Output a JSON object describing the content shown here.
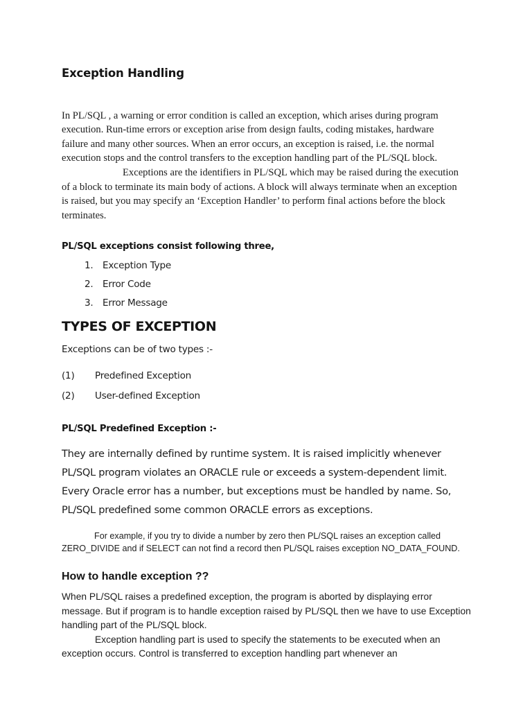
{
  "document": {
    "title": "Exception Handling",
    "intro_paragraph_1": "In PL/SQL , a warning or error condition is called an exception, which arises during program execution. Run-time errors or exception arise from design faults, coding mistakes, hardware failure and many other sources. When an error occurs, an exception is raised, i.e. the normal execution stops and the control transfers to the exception handling part of the PL/SQL block.",
    "intro_paragraph_2": "Exceptions are the identifiers in PL/SQL which may be raised during the execution of a block to terminate its main body of actions. A block will always terminate when an exception is raised, but you may specify an ‘Exception Handler’ to perform final actions before the block terminates.",
    "consist_heading": "PL/SQL exceptions consist following three,",
    "consist_items": [
      {
        "marker": "1.",
        "label": "Exception Type"
      },
      {
        "marker": "2.",
        "label": "Error Code"
      },
      {
        "marker": "3.",
        "label": "Error Message"
      }
    ],
    "types_heading": "TYPES OF EXCEPTION",
    "types_intro": "Exceptions can be of two types :-",
    "types_items": [
      {
        "marker": "(1)",
        "label": "Predefined Exception"
      },
      {
        "marker": "(2)",
        "label": "User-defined Exception"
      }
    ],
    "predefined_heading": "PL/SQL Predefined Exception :-",
    "predefined_body": "They are internally defined by runtime system. It is raised implicitly whenever PL/SQL program violates an ORACLE rule or exceeds a system-dependent limit. Every Oracle error has a number, but exceptions must be handled by name. So, PL/SQL predefined some common ORACLE errors as exceptions.",
    "example_paragraph": "For example, if you try to divide a number by zero then PL/SQL raises an exception called ZERO_DIVIDE and if SELECT can not find a record then PL/SQL raises exception NO_DATA_FOUND.",
    "handle_heading": "How to handle exception ??",
    "handle_paragraph_1": "When PL/SQL raises a predefined exception, the program is aborted by displaying error message. But if program is to handle exception raised by PL/SQL then we have to use Exception handling part of the PL/SQL block.",
    "handle_paragraph_2": "Exception handling part is used to specify the statements to be executed when an exception occurs. Control is transferred to exception handling part whenever an"
  },
  "colors": {
    "page_background": "#ffffff",
    "body_text": "#1d1d1d",
    "heading_text": "#141414"
  }
}
